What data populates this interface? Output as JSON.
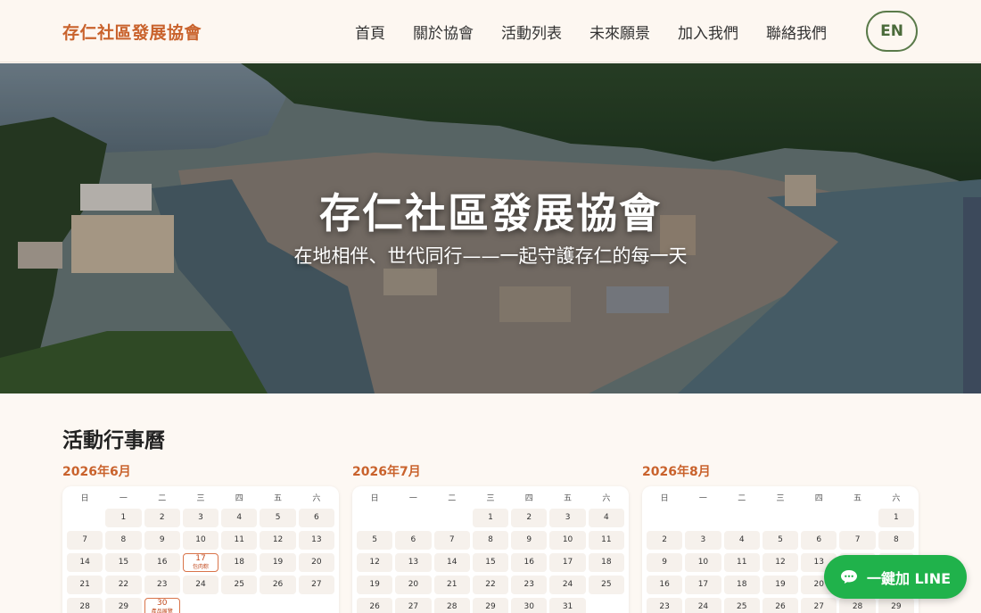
{
  "header": {
    "brand": "存仁社區發展協會",
    "nav": [
      "首頁",
      "關於協會",
      "活動列表",
      "未來願景",
      "加入我們",
      "聯絡我們"
    ],
    "lang_button": "EN"
  },
  "hero": {
    "title": "存仁社區發展協會",
    "subtitle": "在地相伴、世代同行——一起守護存仁的每一天"
  },
  "calendar": {
    "title": "活動行事曆",
    "weekdays": [
      "日",
      "一",
      "二",
      "三",
      "四",
      "五",
      "六"
    ],
    "months": [
      {
        "label": "2026年6月",
        "first_weekday": 1,
        "days_shown": 30,
        "events": [
          {
            "day": 17,
            "label": "包肉粽"
          },
          {
            "day": 30,
            "label": "產品展覽"
          }
        ]
      },
      {
        "label": "2026年7月",
        "first_weekday": 3,
        "days_shown": 31,
        "events": []
      },
      {
        "label": "2026年8月",
        "first_weekday": 6,
        "days_shown": 29,
        "events": []
      }
    ]
  },
  "line_button": {
    "label": "一鍵加 LINE",
    "icon": "chat-bubble-icon"
  },
  "colors": {
    "brand": "#c9622c",
    "line_green": "#20b24b",
    "lang_border": "#5a7a4a",
    "page_bg": "#fdf8f3"
  }
}
